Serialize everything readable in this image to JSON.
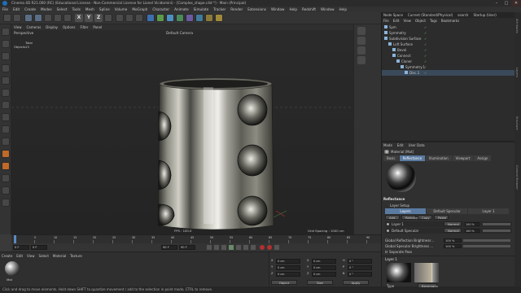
{
  "title_bar": {
    "text": "Cinema 4D R21.000 (RC) (Educational License - Non-Commercial License for Lionel Vicidomini) - [Complex_shape.c4d *] - Main (Principal)",
    "min": "–",
    "max": "□",
    "close": "✕"
  },
  "menu": [
    "File",
    "Edit",
    "Create",
    "Modes",
    "Select",
    "Tools",
    "Mesh",
    "Spline",
    "Volume",
    "MoGraph",
    "Character",
    "Animate",
    "Simulate",
    "Tracker",
    "Render",
    "Extensions",
    "Window",
    "Help",
    "Redshift",
    "Window",
    "Help"
  ],
  "toolbar": {
    "x": "X",
    "y": "Y",
    "z": "Z"
  },
  "viewport": {
    "menu": [
      "View",
      "Cameras",
      "Display",
      "Options",
      "Filter",
      "Panel"
    ],
    "label": "Perspective",
    "camera": "Default Camera",
    "stats": {
      "total": "Total",
      "objects": "Objects",
      "objects_value": "13"
    },
    "fps": "FPS : 100.0",
    "grid": "Grid Spacing : 1000 cm"
  },
  "timeline": {
    "ticks": [
      "0",
      "5",
      "10",
      "15",
      "20",
      "25",
      "30",
      "35",
      "40",
      "45",
      "50",
      "55",
      "60",
      "65",
      "70",
      "75",
      "80",
      "85",
      "90"
    ],
    "frame_field": "0 F",
    "start_field": "0 F",
    "end_field": "90 F",
    "end_field2": "90 F",
    "current": "0 F"
  },
  "material_manager": {
    "menu": [
      "Create",
      "Edit",
      "View",
      "Select",
      "Material",
      "Texture"
    ],
    "material_name": "Mat"
  },
  "coordinates": {
    "rows": [
      {
        "a": "X",
        "av": "0 cm",
        "b": "X",
        "bv": "0 cm",
        "c": "H",
        "cv": "0 °"
      },
      {
        "a": "Y",
        "av": "0 cm",
        "b": "Y",
        "bv": "0 cm",
        "c": "P",
        "cv": "0 °"
      },
      {
        "a": "Z",
        "av": "0 cm",
        "b": "Z",
        "bv": "0 cm",
        "c": "B",
        "cv": "0 °"
      }
    ],
    "mode": "Object (Rel)",
    "size": "Size",
    "apply": "Apply"
  },
  "status": "Click and drag to move elements. Hold down SHIFT to quantize movement / add to the selection in point mode, CTRL to remove.",
  "object_manager": {
    "top_tabs": [
      "Node Space",
      "Current (Standard/Physical)",
      "search",
      "Startup (User)"
    ],
    "menu": [
      "File",
      "Edit",
      "View",
      "Object",
      "Tags",
      "Bookmarks"
    ],
    "objects": [
      {
        "name": "Sym",
        "indent": 0,
        "color": "#8ab3d9"
      },
      {
        "name": "Symmetry",
        "indent": 0,
        "color": "#8ab3d9"
      },
      {
        "name": "Subdivision Surface",
        "indent": 0,
        "color": "#8ab3d9"
      },
      {
        "name": "Loft Surface",
        "indent": 1,
        "color": "#8ab3d9"
      },
      {
        "name": "Bevel",
        "indent": 2,
        "color": "#8ab3d9"
      },
      {
        "name": "Connect",
        "indent": 2,
        "color": "#8ab3d9"
      },
      {
        "name": "Cloner",
        "indent": 3,
        "color": "#8ab3d9"
      },
      {
        "name": "Symmetry.1",
        "indent": 4,
        "color": "#8ab3d9"
      },
      {
        "name": "Disc.1",
        "indent": 5,
        "color": "#8ab3d9"
      }
    ]
  },
  "attribute_manager": {
    "menu": [
      "Mode",
      "Edit",
      "User Data"
    ],
    "title": "Material [Mat]",
    "tabs": [
      "Basic",
      "Reflectance",
      "Illumination",
      "Viewport",
      "Assign"
    ],
    "active_tab": "Reflectance",
    "section": "Reflectance",
    "layer_setup": "Layer Setup",
    "layer_tabs": [
      "Layers",
      "Default Specular",
      "Layer 1"
    ],
    "layer_buttons": [
      "Add...",
      "Remove",
      "Copy",
      "Paste"
    ],
    "layers": [
      {
        "name": "Layer 1",
        "mode": "Normal",
        "value": "100 %"
      },
      {
        "name": "Default Specular",
        "mode": "Normal",
        "value": "100 %"
      }
    ],
    "global_reflection": "Global Reflection Brightness ..",
    "global_reflection_value": "100 %",
    "global_specular": "Global Specular Brightness ...",
    "global_specular_value": "100 %",
    "separate_pass": "Separate Pass",
    "layer1_label": "Layer 1",
    "type_label": "Type",
    "type_value": "Beckmann"
  },
  "right_tabs": [
    "Attributes",
    "Layers",
    "Structure",
    "Content Browser"
  ]
}
